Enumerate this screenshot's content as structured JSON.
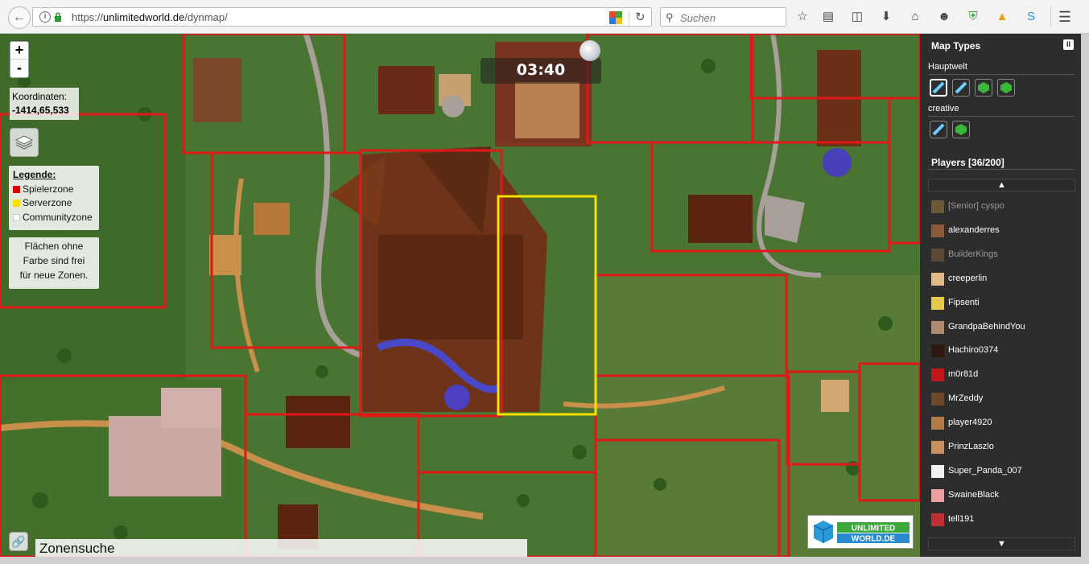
{
  "browser": {
    "url_prefix": "https://",
    "url_host": "unlimitedworld.de",
    "url_path": "/dynmap/",
    "search_placeholder": "Suchen"
  },
  "map": {
    "zoom_in_label": "+",
    "zoom_out_label": "-",
    "coords_label": "Koordinaten:",
    "coords_value": "-1414,65,533",
    "clock": "03:40",
    "legend": {
      "title": "Legende:",
      "items": [
        {
          "label": "Spielerzone",
          "color": "#e00000"
        },
        {
          "label": "Serverzone",
          "color": "#f5e000"
        },
        {
          "label": "Communityzone",
          "color": "#ffffff"
        }
      ]
    },
    "note_lines": [
      "Flächen ohne",
      "Farbe sind frei",
      "für neue Zonen."
    ],
    "search_label": "Zonensuche",
    "logo_text_1": "UNLIMITED",
    "logo_text_2": "WORLD.DE"
  },
  "sidebar": {
    "map_types_title": "Map Types",
    "pause_label": "II",
    "world1_name": "Hauptwelt",
    "world2_name": "creative",
    "players_title": "Players [36/200]",
    "scroll_up": "▲",
    "scroll_down": "▼",
    "players": [
      {
        "name": "[Senior] cyspo",
        "dim": true,
        "face": "#6b5a3a"
      },
      {
        "name": "alexanderres",
        "dim": false,
        "face": "#8a5a3a"
      },
      {
        "name": "BuilderKings",
        "dim": true,
        "face": "#5a4a35"
      },
      {
        "name": "creeperlin",
        "dim": false,
        "face": "#e0b98a"
      },
      {
        "name": "Fipsenti",
        "dim": false,
        "face": "#e6c84a"
      },
      {
        "name": "GrandpaBehindYou",
        "dim": false,
        "face": "#b08a70"
      },
      {
        "name": "Hachiro0374",
        "dim": false,
        "face": "#2a1a10"
      },
      {
        "name": "m0r81d",
        "dim": false,
        "face": "#c01818"
      },
      {
        "name": "MrZeddy",
        "dim": false,
        "face": "#6a4a2a"
      },
      {
        "name": "player4920",
        "dim": false,
        "face": "#b07a4a"
      },
      {
        "name": "PrinzLaszlo",
        "dim": false,
        "face": "#c89060"
      },
      {
        "name": "Super_Panda_007",
        "dim": false,
        "face": "#f0f0f0"
      },
      {
        "name": "SwaineBlack",
        "dim": false,
        "face": "#e8a0a0"
      },
      {
        "name": "tell191",
        "dim": false,
        "face": "#c03030"
      }
    ]
  }
}
